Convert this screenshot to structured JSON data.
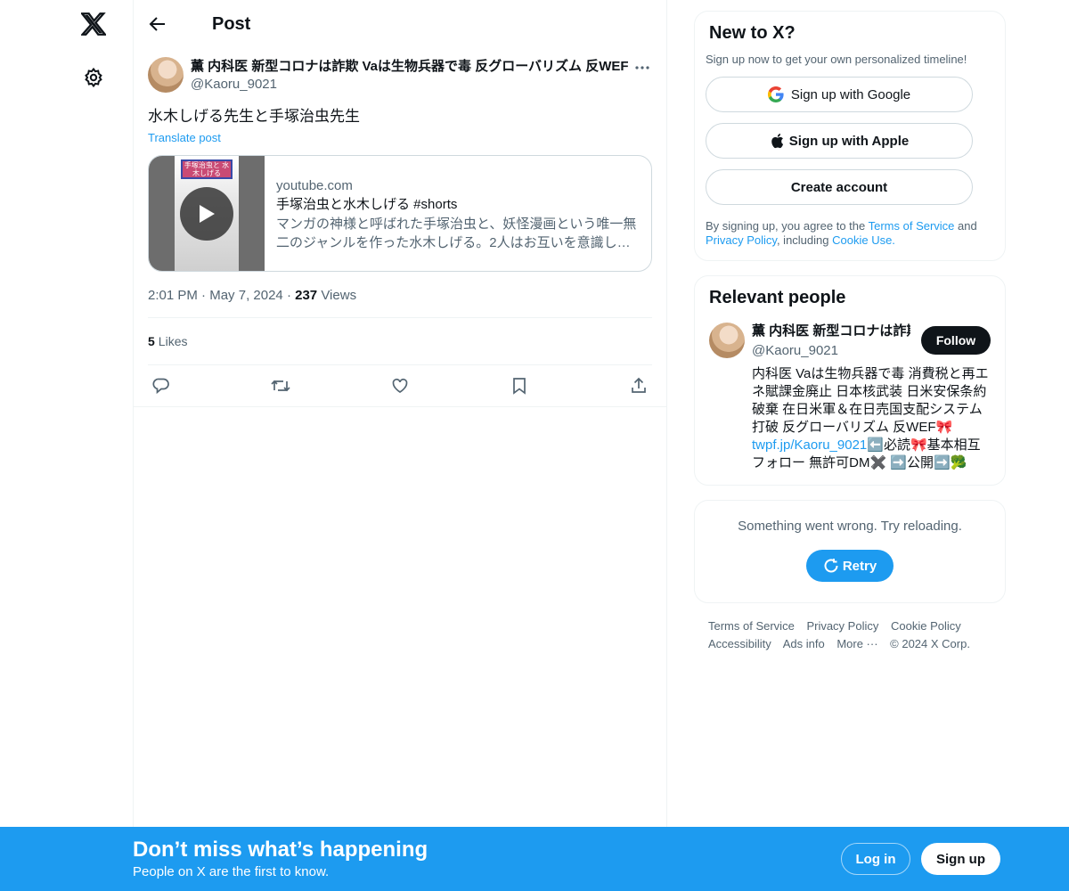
{
  "header": {
    "title": "Post"
  },
  "post": {
    "author_name": "薫 内科医 新型コロナは詐欺 Vaは生物兵器で毒 反グローバリズム 反WEF",
    "author_handle": "@Kaoru_9021",
    "text": "水木しげる先生と手塚治虫先生",
    "translate_label": "Translate post",
    "card": {
      "thumb_caption": "手塚治虫と 水木しげる",
      "domain": "youtube.com",
      "title": "手塚治虫と水木しげる #shorts",
      "description": "マンガの神様と呼ばれた手塚治虫と、妖怪漫画という唯一無二のジャンルを作った水木しげる。2人はお互いを意識し…"
    },
    "time": "2:01 PM",
    "date": "May 7, 2024",
    "views_count": "237",
    "views_label": "Views",
    "likes_count": "5",
    "likes_label": "Likes"
  },
  "signup_panel": {
    "title": "New to X?",
    "subtitle": "Sign up now to get your own personalized timeline!",
    "google_label": "Sign up with Google",
    "apple_label": "Sign up with Apple",
    "create_label": "Create account",
    "legal_prefix": "By signing up, you agree to the ",
    "terms_link": "Terms of Service",
    "legal_and": " and ",
    "privacy_link": "Privacy Policy",
    "legal_including": ", including ",
    "cookie_link": "Cookie Use."
  },
  "relevant": {
    "title": "Relevant people",
    "name": "薫 内科医 新型コロナは詐欺",
    "handle": "@Kaoru_9021",
    "follow_label": "Follow",
    "bio_text": "内科医 Vaは生物兵器で毒 消費税と再エネ賦課金廃止 日本核武装 日米安保条約破棄 在日米軍＆在日売国支配システム打破 反グローバリズム 反WEF🎀 ",
    "bio_link": "twpf.jp/Kaoru_9021",
    "bio_tail": "⬅️必読🎀基本相互フォロー 無許可DM✖️ ➡️公開➡️🥦"
  },
  "error_panel": {
    "message": "Something went wrong. Try reloading.",
    "retry_label": "Retry"
  },
  "footer": {
    "links": [
      "Terms of Service",
      "Privacy Policy",
      "Cookie Policy",
      "Accessibility",
      "Ads info",
      "More ···",
      "© 2024 X Corp."
    ]
  },
  "bottom_bar": {
    "title": "Don’t miss what’s happening",
    "subtitle": "People on X are the first to know.",
    "login_label": "Log in",
    "signup_label": "Sign up"
  },
  "colors": {
    "accent": "#1d9bf0",
    "text": "#0f1419",
    "muted": "#536471",
    "border": "#eff3f4"
  },
  "icons": [
    "x-logo-icon",
    "gear-icon",
    "back-arrow-icon",
    "more-icon",
    "play-icon",
    "reply-icon",
    "repost-icon",
    "like-icon",
    "bookmark-icon",
    "share-icon",
    "google-icon",
    "apple-icon",
    "refresh-icon"
  ]
}
